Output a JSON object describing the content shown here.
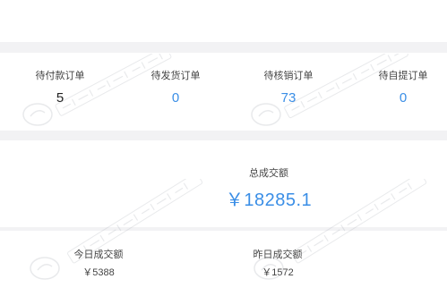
{
  "orders": [
    {
      "label": "待付款订单",
      "value": "5",
      "tone": "dark"
    },
    {
      "label": "待发货订单",
      "value": "0",
      "tone": "accent"
    },
    {
      "label": "待核销订单",
      "value": "73",
      "tone": "accent"
    },
    {
      "label": "待自提订单",
      "value": "0",
      "tone": "accent"
    }
  ],
  "total": {
    "label": "总成交额",
    "value": "￥18285.1"
  },
  "today": {
    "label": "今日成交额",
    "value": "￥5388"
  },
  "yesterday": {
    "label": "昨日成交额",
    "value": "￥1572"
  },
  "colors": {
    "accent": "#3a8ee6",
    "background": "#f2f2f4",
    "panel": "#ffffff"
  }
}
